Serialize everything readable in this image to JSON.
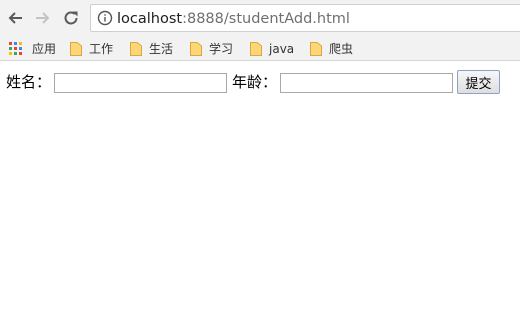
{
  "browser": {
    "url_host": "localhost",
    "url_path": ":8888/studentAdd.html",
    "colors": {
      "toolbar_bg": "#f2f2f2",
      "nav_icon_active": "#5a5a5a",
      "nav_icon_disabled": "#c3c3c3",
      "folder": "#fcd677"
    }
  },
  "bookmarks": {
    "apps_label": "应用",
    "items": [
      {
        "label": "工作",
        "icon": "folder-icon"
      },
      {
        "label": "生活",
        "icon": "folder-icon"
      },
      {
        "label": "学习",
        "icon": "folder-icon"
      },
      {
        "label": "java",
        "icon": "folder-icon"
      },
      {
        "label": "爬虫",
        "icon": "folder-icon"
      }
    ]
  },
  "form": {
    "name_label": "姓名：",
    "name_value": "",
    "age_label": "年龄：",
    "age_value": "",
    "submit_label": "提交"
  }
}
